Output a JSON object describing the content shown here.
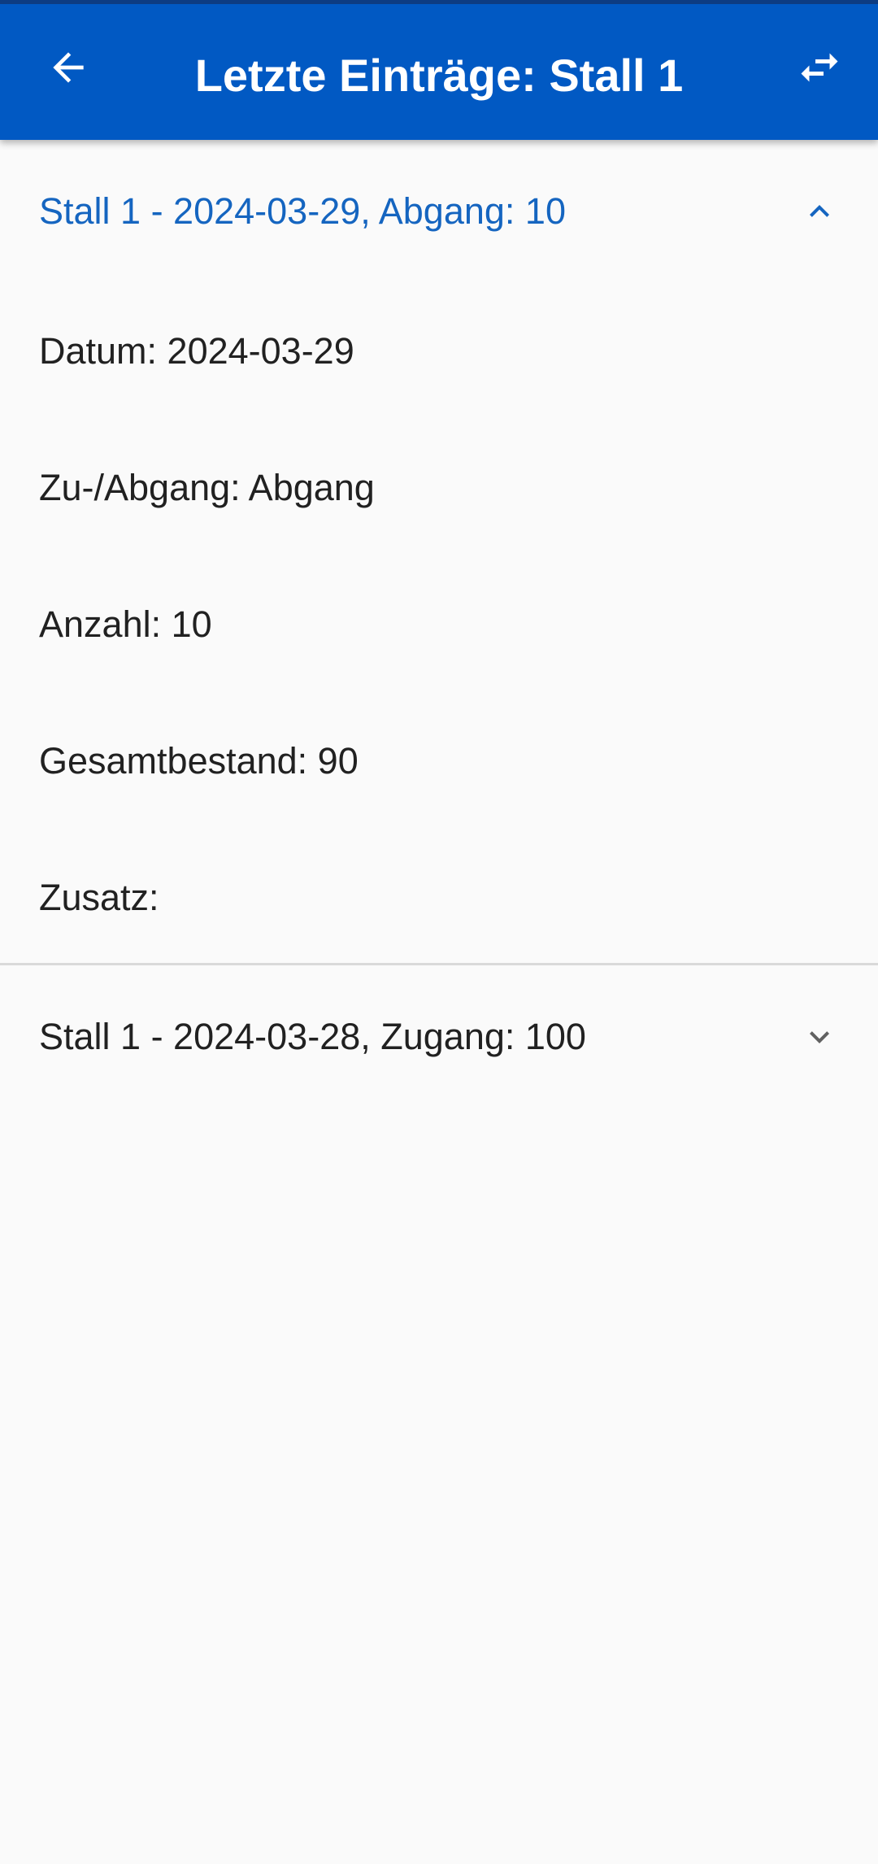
{
  "app_bar": {
    "title": "Letzte Einträge: Stall 1",
    "back_icon": "arrow-left-icon",
    "action_icon": "swap-horiz-icon",
    "color": "#0159c3"
  },
  "entries": [
    {
      "header": "Stall 1 - 2024-03-29, Abgang: 10",
      "expanded": true,
      "details": {
        "datum": "Datum: 2024-03-29",
        "zu_abgang": "Zu-/Abgang: Abgang",
        "anzahl": "Anzahl: 10",
        "gesamtbestand": "Gesamtbestand: 90",
        "zusatz": "Zusatz:"
      }
    },
    {
      "header": "Stall 1 - 2024-03-28, Zugang: 100",
      "expanded": false
    }
  ],
  "colors": {
    "accent": "#1565c0",
    "background": "#fafafa",
    "text": "#212121"
  }
}
